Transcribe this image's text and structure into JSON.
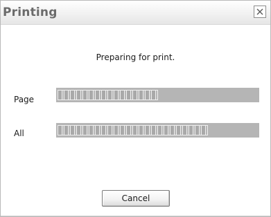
{
  "window": {
    "title": "Printing",
    "close_icon": "close-icon"
  },
  "message": "Preparing for print.",
  "progress": {
    "page": {
      "label": "Page",
      "fraction": 0.5
    },
    "all": {
      "label": "All",
      "fraction": 0.75
    }
  },
  "buttons": {
    "cancel_label": "Cancel"
  },
  "colors": {
    "progress_track": "#b5b5b5",
    "progress_segment": "#a9a9a9",
    "title_text": "#6b6b6b"
  }
}
